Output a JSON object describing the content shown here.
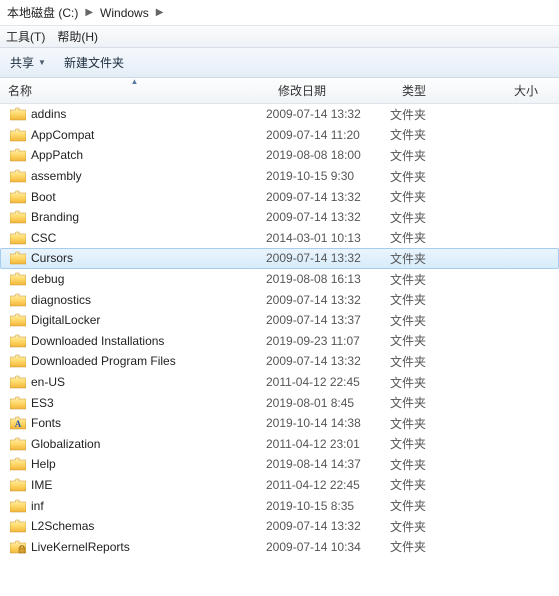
{
  "breadcrumb": {
    "items": [
      "本地磁盘 (C:)",
      "Windows"
    ]
  },
  "menubar": {
    "tools": "工具(T)",
    "help": "帮助(H)"
  },
  "toolbar": {
    "share": "共享",
    "newfolder": "新建文件夹"
  },
  "columns": {
    "name": "名称",
    "date": "修改日期",
    "type": "类型",
    "size": "大小"
  },
  "folder_label": "文件夹",
  "rows": [
    {
      "name": "addins",
      "date": "2009-07-14 13:32",
      "icon": "folder"
    },
    {
      "name": "AppCompat",
      "date": "2009-07-14 11:20",
      "icon": "folder"
    },
    {
      "name": "AppPatch",
      "date": "2019-08-08 18:00",
      "icon": "folder"
    },
    {
      "name": "assembly",
      "date": "2019-10-15 9:30",
      "icon": "folder"
    },
    {
      "name": "Boot",
      "date": "2009-07-14 13:32",
      "icon": "folder"
    },
    {
      "name": "Branding",
      "date": "2009-07-14 13:32",
      "icon": "folder"
    },
    {
      "name": "CSC",
      "date": "2014-03-01 10:13",
      "icon": "folder"
    },
    {
      "name": "Cursors",
      "date": "2009-07-14 13:32",
      "icon": "folder",
      "selected": true
    },
    {
      "name": "debug",
      "date": "2019-08-08 16:13",
      "icon": "folder"
    },
    {
      "name": "diagnostics",
      "date": "2009-07-14 13:32",
      "icon": "folder"
    },
    {
      "name": "DigitalLocker",
      "date": "2009-07-14 13:37",
      "icon": "folder"
    },
    {
      "name": "Downloaded Installations",
      "date": "2019-09-23 11:07",
      "icon": "folder"
    },
    {
      "name": "Downloaded Program Files",
      "date": "2009-07-14 13:32",
      "icon": "folder"
    },
    {
      "name": "en-US",
      "date": "2011-04-12 22:45",
      "icon": "folder"
    },
    {
      "name": "ES3",
      "date": "2019-08-01 8:45",
      "icon": "folder"
    },
    {
      "name": "Fonts",
      "date": "2019-10-14 14:38",
      "icon": "fonts"
    },
    {
      "name": "Globalization",
      "date": "2011-04-12 23:01",
      "icon": "folder"
    },
    {
      "name": "Help",
      "date": "2019-08-14 14:37",
      "icon": "folder"
    },
    {
      "name": "IME",
      "date": "2011-04-12 22:45",
      "icon": "folder"
    },
    {
      "name": "inf",
      "date": "2019-10-15 8:35",
      "icon": "folder"
    },
    {
      "name": "L2Schemas",
      "date": "2009-07-14 13:32",
      "icon": "folder"
    },
    {
      "name": "LiveKernelReports",
      "date": "2009-07-14 10:34",
      "icon": "folderlock"
    }
  ]
}
